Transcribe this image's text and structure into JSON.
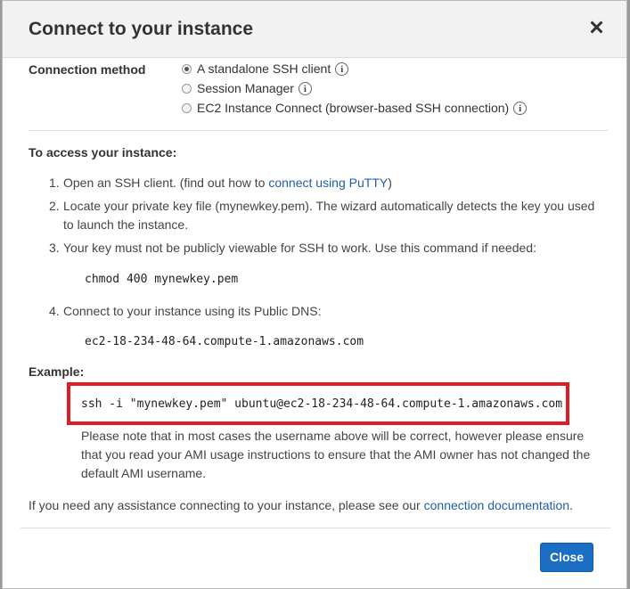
{
  "dialog": {
    "title": "Connect to your instance",
    "close_icon": "close-icon",
    "connection_method": {
      "label": "Connection method",
      "options": [
        {
          "label": "A standalone SSH client",
          "selected": true
        },
        {
          "label": "Session Manager",
          "selected": false
        },
        {
          "label": "EC2 Instance Connect (browser-based SSH connection)",
          "selected": false
        }
      ],
      "info_glyph": "i"
    },
    "access": {
      "heading": "To access your instance:",
      "steps": [
        {
          "num": "1.",
          "text": "Open an SSH client. (find out how to ",
          "link": "connect using PuTTY",
          "after": ")"
        },
        {
          "num": "2.",
          "text_line1": "Locate your private key file (mynewkey.pem). The wizard automatically detects the key you used",
          "text_line2": "to launch the instance."
        },
        {
          "num": "3.",
          "text": "Your key must not be publicly viewable for SSH to work. Use this command if needed:",
          "code": "chmod 400 mynewkey.pem"
        },
        {
          "num": "4.",
          "text": "Connect to your instance using its Public DNS:",
          "code": "ec2-18-234-48-64.compute-1.amazonaws.com"
        }
      ]
    },
    "example": {
      "heading": "Example:",
      "command": "ssh -i \"mynewkey.pem\" ubuntu@ec2-18-234-48-64.compute-1.amazonaws.com",
      "note_line1": "Please note that in most cases the username above will be correct, however please ensure",
      "note_line2": "that you read your AMI usage instructions to ensure that the AMI owner has not changed the",
      "note_line3": "default AMI username."
    },
    "assistance": {
      "text": "If you need any assistance connecting to your instance, please see our ",
      "link": "connection documentation",
      "after": "."
    },
    "close_button": "Close",
    "colors": {
      "highlight": "#e11b22",
      "primary_button": "#1a6fc4",
      "link": "#1f5fa8"
    }
  }
}
